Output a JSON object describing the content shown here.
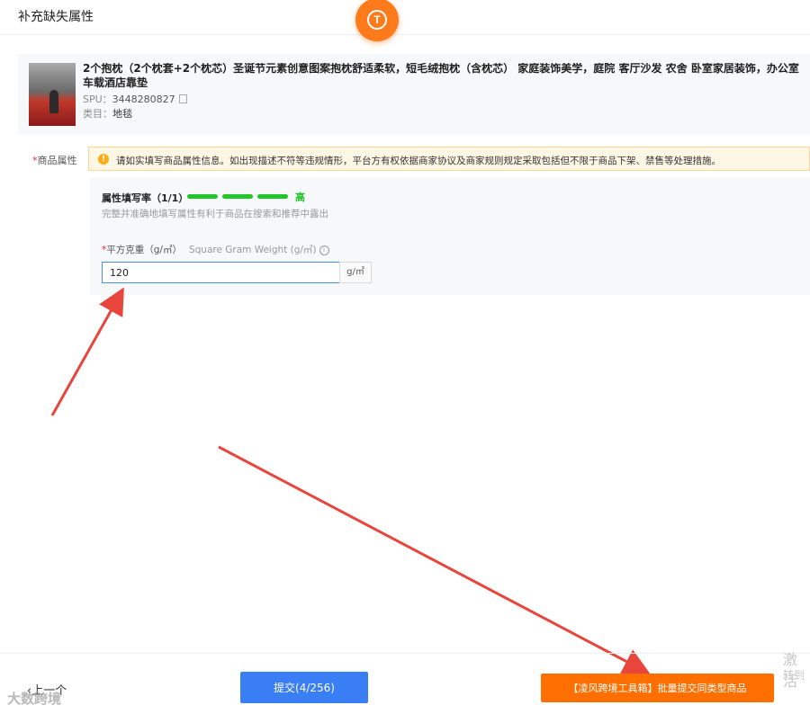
{
  "header": {
    "title": "补充缺失属性"
  },
  "logo": {
    "letter": "T"
  },
  "product": {
    "title_line1": "2个抱枕（2个枕套+2个枕芯）圣诞节元素创意图案抱枕舒适柔软，短毛绒抱枕（含枕芯） 家庭装饰美学，庭院 客厅沙发 农舍 卧室家居装饰，办公室",
    "title_line2": "车载酒店靠垫",
    "spu_label": "SPU：",
    "spu_value": "3448280827",
    "category_label": "类目：",
    "category_value": "地毯"
  },
  "attributes": {
    "section_label": "商品属性",
    "notice": "请如实填写商品属性信息。如出现描述不符等违规情形，平台方有权依据商家协议及商家规则规定采取包括但不限于商品下架、禁售等处理措施。",
    "fill_rate_label": "属性填写率（1/1）",
    "fill_rate_fraction": 1,
    "fill_level": "高",
    "fill_hint": "完整并准确地填写属性有利于商品在搜索和推荐中露出",
    "field": {
      "label_cn": "平方克重（g/㎡）",
      "label_en": "Square Gram Weight (g/㎡)",
      "value": "120",
      "unit": "g/㎡"
    }
  },
  "footer": {
    "prev": "上一个",
    "submit": "提交(4/256)",
    "batch_submit": "【凌风跨境工具箱】批量提交同类型商品"
  },
  "overlay": {
    "watermark": "大数跨境",
    "activate_line1": "激活",
    "activate_line2": "转到"
  },
  "colors": {
    "accent_blue": "#3a7ef5",
    "accent_orange": "#ff6f00",
    "progress_green": "#22c52a",
    "arrow_red": "#e8453c"
  }
}
